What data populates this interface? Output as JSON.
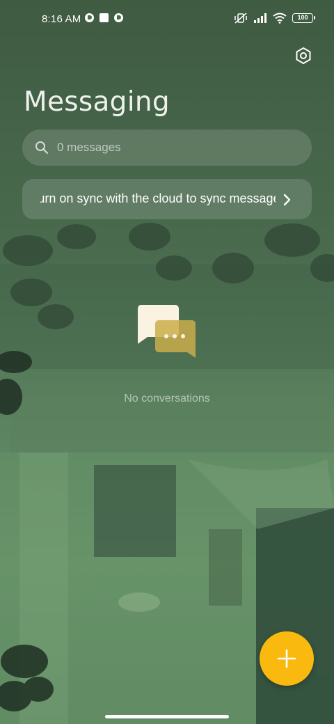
{
  "status_bar": {
    "time": "8:16 AM",
    "battery": "100",
    "icons": [
      "app-notification-icon",
      "square-notification-icon",
      "app-notification-icon",
      "vibrate-mute-icon",
      "signal-icon",
      "wifi-icon",
      "battery-icon"
    ]
  },
  "header": {
    "title": "Messaging",
    "settings_icon": "settings-icon"
  },
  "search": {
    "placeholder": "0 messages",
    "icon": "search-icon"
  },
  "sync_banner": {
    "text": "Turn on sync with the cloud to sync messages",
    "icon": "chevron-right-icon"
  },
  "empty_state": {
    "icon": "chat-bubbles-icon",
    "text": "No conversations"
  },
  "fab": {
    "icon": "plus-icon",
    "color": "#f9b90f"
  },
  "colors": {
    "accent": "#f9b90f",
    "background": "#4a6a4e"
  }
}
